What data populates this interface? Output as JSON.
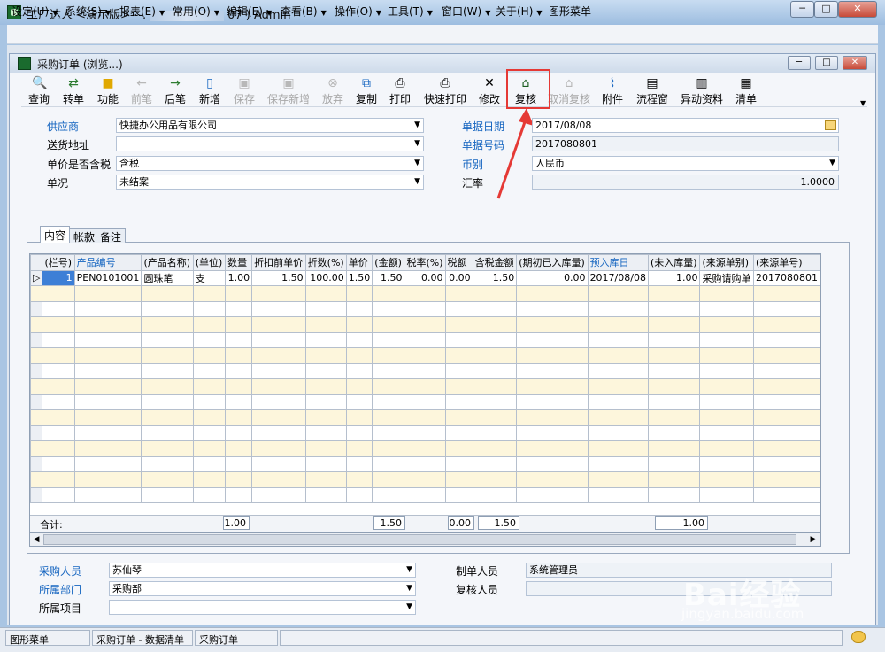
{
  "window": {
    "title": "工厂达人 <演示版>---.",
    "title_tail": "07 ) Admin",
    "btn_min": "─",
    "btn_max": "□",
    "btn_close": "✕"
  },
  "menu": [
    {
      "label": "设定(U)"
    },
    {
      "label": "系统(S)"
    },
    {
      "label": "报表(E)"
    },
    {
      "label": "常用(O)"
    },
    {
      "label": "编辑(E)"
    },
    {
      "label": "查看(B)"
    },
    {
      "label": "操作(O)"
    },
    {
      "label": "工具(T)"
    },
    {
      "label": "窗口(W)"
    },
    {
      "label": "关于(H)"
    },
    {
      "label": "图形菜单"
    }
  ],
  "child_window": {
    "title": "采购订单 (浏览...)"
  },
  "toolbar": [
    {
      "label": "查询",
      "icon": "search-icon",
      "enabled": true
    },
    {
      "label": "转单",
      "icon": "transfer-icon",
      "enabled": true
    },
    {
      "label": "功能",
      "icon": "box-icon",
      "enabled": true
    },
    {
      "label": "前笔",
      "icon": "arrow-left-icon",
      "enabled": false
    },
    {
      "label": "后笔",
      "icon": "arrow-right-icon",
      "enabled": true
    },
    {
      "label": "新增",
      "icon": "new-document-icon",
      "enabled": true
    },
    {
      "label": "保存",
      "icon": "save-icon",
      "enabled": false
    },
    {
      "label": "保存新增",
      "icon": "save-new-icon",
      "enabled": false
    },
    {
      "label": "放弃",
      "icon": "cancel-icon",
      "enabled": false
    },
    {
      "label": "复制",
      "icon": "copy-icon",
      "enabled": true
    },
    {
      "label": "打印",
      "icon": "printer-icon",
      "enabled": true
    },
    {
      "label": "快速打印",
      "icon": "quick-print-icon",
      "enabled": true
    },
    {
      "label": "修改",
      "icon": "tools-icon",
      "enabled": true
    },
    {
      "label": "复核",
      "icon": "approve-icon",
      "enabled": true
    },
    {
      "label": "取消复核",
      "icon": "unapprove-icon",
      "enabled": false
    },
    {
      "label": "附件",
      "icon": "paperclip-icon",
      "enabled": true
    },
    {
      "label": "流程窗",
      "icon": "flowchart-icon",
      "enabled": true
    },
    {
      "label": "异动资料",
      "icon": "change-data-icon",
      "enabled": true
    },
    {
      "label": "清单",
      "icon": "list-icon",
      "enabled": true
    }
  ],
  "header": {
    "supplier_label": "供应商",
    "supplier": "快捷办公用品有限公司",
    "address_label": "送货地址",
    "address": "",
    "tax_incl_label": "单价是否含税",
    "tax_incl": "含税",
    "status_label": "单况",
    "status": "未结案",
    "date_label": "单据日期",
    "date": "2017/08/08",
    "doc_no_label": "单据号码",
    "doc_no": "2017080801",
    "currency_label": "币别",
    "currency": "人民币",
    "rate_label": "汇率",
    "rate": "1.0000"
  },
  "tabs": [
    {
      "label": "内容"
    },
    {
      "label": "帐款"
    },
    {
      "label": "备注"
    }
  ],
  "grid": {
    "columns": [
      "(栏号)",
      "产品编号",
      "(产品名称)",
      "(单位)",
      "数量",
      "折扣前单价",
      "折数(%)",
      "单价",
      "(金额)",
      "税率(%)",
      "税额",
      "含税金额",
      "(期初已入库量)",
      "预入库日",
      "(未入库量)",
      "(来源单别)",
      "(来源单号)"
    ],
    "rows": [
      [
        "1",
        "PEN0101001",
        "圆珠笔",
        "支",
        "1.00",
        "1.50",
        "100.00",
        "1.50",
        "1.50",
        "0.00",
        "0.00",
        "1.50",
        "0.00",
        "2017/08/08",
        "1.00",
        "采购请购单",
        "2017080801"
      ]
    ],
    "total_label": "合计:",
    "totals": {
      "qty": "1.00",
      "amount": "1.50",
      "tax": "0.00",
      "incl_amount": "1.50",
      "uninbound": "1.00"
    }
  },
  "footer": {
    "buyer_label": "采购人员",
    "buyer": "苏仙琴",
    "dept_label": "所属部门",
    "dept": "采购部",
    "project_label": "所属项目",
    "project": "",
    "maker_label": "制单人员",
    "maker": "系统管理员",
    "reviewer_label": "复核人员",
    "reviewer": ""
  },
  "statusbar": [
    "图形菜单",
    "采购订单 - 数据清单",
    "采购订单"
  ],
  "watermark": {
    "brand": "Bai经验",
    "url": "jingyan.baidu.com"
  },
  "colors": {
    "accent_link": "#1565c0",
    "highlight_red": "#e53935",
    "row_band": "#fdf6dc",
    "selected_cell": "#3d7fd6"
  }
}
